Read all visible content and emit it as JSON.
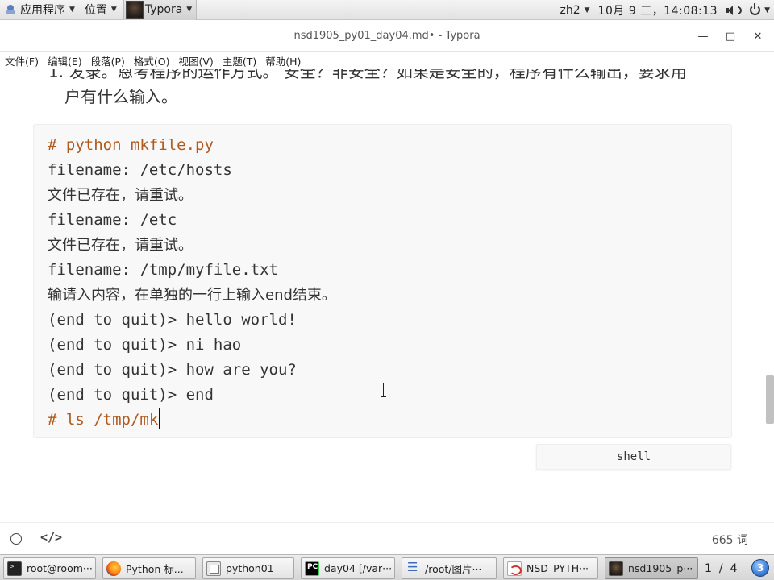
{
  "topbar": {
    "apps_label": "应用程序",
    "places_label": "位置",
    "typora_label": "Typora",
    "input_method": "zh2",
    "clock": "10月  9 三，14:08:13"
  },
  "window": {
    "title": "nsd1905_py01_day04.md• - Typora",
    "minimize": "—",
    "maximize": "□",
    "close": "✕"
  },
  "menu": [
    "文件(F)",
    "编辑(E)",
    "段落(P)",
    "格式(O)",
    "视图(V)",
    "主题(T)",
    "帮助(H)"
  ],
  "document": {
    "para_line1": "1. 发录。恩考程序的运作方式。 安全？非安全？如果是安全的，程序有什么输出，要求用",
    "para_line2": "户有什么输入。",
    "code_lines": [
      "# python mkfile.py",
      "filename: /etc/hosts",
      "文件已存在，请重试。",
      "filename: /etc",
      "文件已存在，请重试。",
      "filename: /tmp/myfile.txt",
      "输请入内容，在单独的一行上输入end结束。",
      "(end to quit)> hello world!",
      "(end to quit)> ni hao",
      "(end to quit)> how are you?",
      "(end to quit)> end",
      "# ls /tmp/mk"
    ],
    "code_language": "shell"
  },
  "statusbar": {
    "source_toggle": "</>",
    "word_count": "665 词"
  },
  "taskbar": {
    "tasks": [
      "root@room···",
      "Python 标...",
      "python01",
      "day04 [/var···",
      "/root/图片···",
      "NSD_PYTH···",
      "nsd1905_p···"
    ],
    "pager_current": "1",
    "pager_total": "4",
    "badge": "3"
  },
  "colors": {
    "comment": "#b05a1d",
    "code_background": "#f8f8f8"
  }
}
